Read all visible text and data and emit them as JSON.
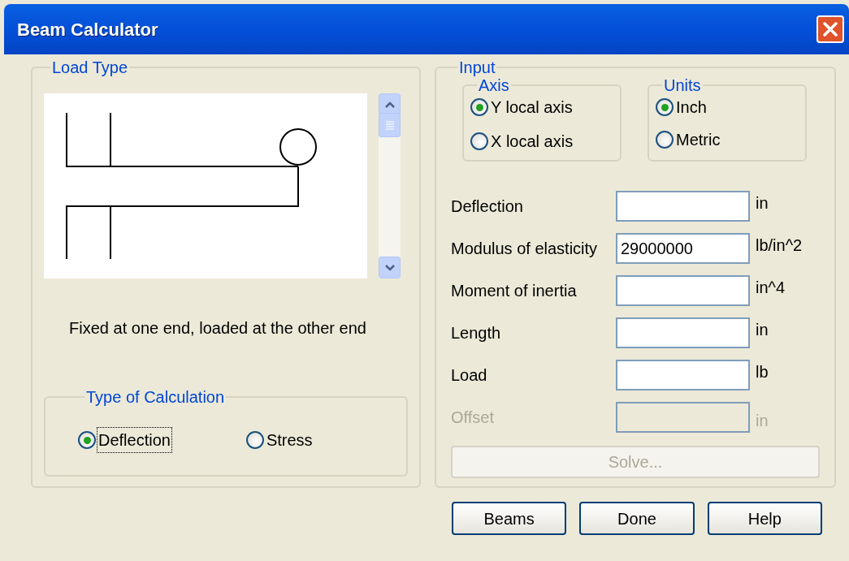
{
  "window": {
    "title": "Beam Calculator"
  },
  "load_type": {
    "title": "Load Type",
    "description": "Fixed at one end, loaded at the other end"
  },
  "calculation": {
    "title": "Type of Calculation",
    "options": [
      {
        "label": "Deflection",
        "selected": true,
        "focused": true
      },
      {
        "label": "Stress",
        "selected": false,
        "focused": false
      }
    ]
  },
  "input": {
    "title": "Input",
    "axis": {
      "title": "Axis",
      "options": [
        {
          "label": "Y local axis",
          "selected": true
        },
        {
          "label": "X local axis",
          "selected": false
        }
      ]
    },
    "units": {
      "title": "Units",
      "options": [
        {
          "label": "Inch",
          "selected": true
        },
        {
          "label": "Metric",
          "selected": false
        }
      ]
    },
    "fields": [
      {
        "label": "Deflection",
        "unit": "in",
        "disabled": false
      },
      {
        "label": "Modulus of elasticity",
        "value": "29000000",
        "unit": "lb/in^2",
        "disabled": false
      },
      {
        "label": "Moment of inertia",
        "unit": "in^4",
        "disabled": false
      },
      {
        "label": "Length",
        "unit": "in",
        "disabled": false
      },
      {
        "label": "Load",
        "unit": "lb",
        "disabled": false
      },
      {
        "label": "Offset",
        "unit": "in",
        "disabled": true
      }
    ],
    "solve": {
      "label": "Solve...",
      "disabled": true
    }
  },
  "buttons": [
    "Beams",
    "Done",
    "Help"
  ]
}
